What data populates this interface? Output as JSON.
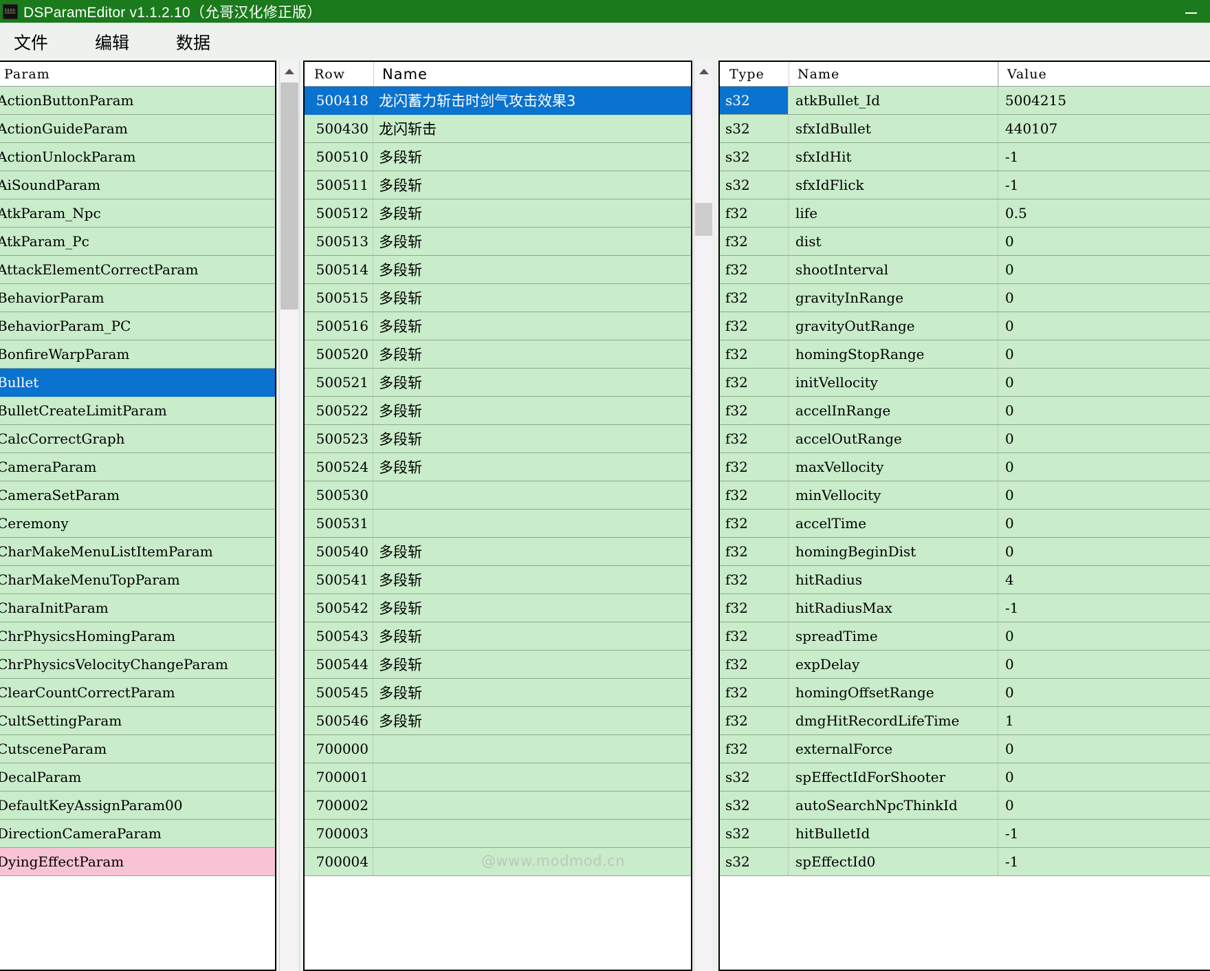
{
  "window": {
    "title": "DSParamEditor v1.1.2.10（允哥汉化修正版）",
    "icon": "app-icon",
    "minimize_label": "—"
  },
  "menubar": {
    "items": [
      {
        "label": "文件"
      },
      {
        "label": "编辑"
      },
      {
        "label": "数据"
      }
    ]
  },
  "param_panel": {
    "header": "Param",
    "selected": "Bullet",
    "items": [
      {
        "label": "ActionButtonParam",
        "state": "normal"
      },
      {
        "label": "ActionGuideParam",
        "state": "normal"
      },
      {
        "label": "ActionUnlockParam",
        "state": "normal"
      },
      {
        "label": "AiSoundParam",
        "state": "normal"
      },
      {
        "label": "AtkParam_Npc",
        "state": "normal"
      },
      {
        "label": "AtkParam_Pc",
        "state": "normal"
      },
      {
        "label": "AttackElementCorrectParam",
        "state": "normal"
      },
      {
        "label": "BehaviorParam",
        "state": "normal"
      },
      {
        "label": "BehaviorParam_PC",
        "state": "normal"
      },
      {
        "label": "BonfireWarpParam",
        "state": "normal"
      },
      {
        "label": "Bullet",
        "state": "selected"
      },
      {
        "label": "BulletCreateLimitParam",
        "state": "normal"
      },
      {
        "label": "CalcCorrectGraph",
        "state": "normal"
      },
      {
        "label": "CameraParam",
        "state": "normal"
      },
      {
        "label": "CameraSetParam",
        "state": "normal"
      },
      {
        "label": "Ceremony",
        "state": "normal"
      },
      {
        "label": "CharMakeMenuListItemParam",
        "state": "normal"
      },
      {
        "label": "CharMakeMenuTopParam",
        "state": "normal"
      },
      {
        "label": "CharaInitParam",
        "state": "normal"
      },
      {
        "label": "ChrPhysicsHomingParam",
        "state": "normal"
      },
      {
        "label": "ChrPhysicsVelocityChangeParam",
        "state": "normal"
      },
      {
        "label": "ClearCountCorrectParam",
        "state": "normal"
      },
      {
        "label": "CultSettingParam",
        "state": "normal"
      },
      {
        "label": "CutsceneParam",
        "state": "normal"
      },
      {
        "label": "DecalParam",
        "state": "normal"
      },
      {
        "label": "DefaultKeyAssignParam00",
        "state": "normal"
      },
      {
        "label": "DirectionCameraParam",
        "state": "normal"
      },
      {
        "label": "DyingEffectParam",
        "state": "pink"
      }
    ]
  },
  "rows_panel": {
    "headers": {
      "row": "Row",
      "name": "Name"
    },
    "rows": [
      {
        "row": "500418",
        "name": "龙闪蓄力斩击时剑气攻击效果3",
        "state": "selected"
      },
      {
        "row": "500430",
        "name": "龙闪斩击",
        "state": "normal"
      },
      {
        "row": "500510",
        "name": "多段斩",
        "state": "normal"
      },
      {
        "row": "500511",
        "name": "多段斩",
        "state": "normal"
      },
      {
        "row": "500512",
        "name": "多段斩",
        "state": "normal"
      },
      {
        "row": "500513",
        "name": "多段斩",
        "state": "normal"
      },
      {
        "row": "500514",
        "name": "多段斩",
        "state": "normal"
      },
      {
        "row": "500515",
        "name": "多段斩",
        "state": "normal"
      },
      {
        "row": "500516",
        "name": "多段斩",
        "state": "normal"
      },
      {
        "row": "500520",
        "name": "多段斩",
        "state": "normal"
      },
      {
        "row": "500521",
        "name": "多段斩",
        "state": "normal"
      },
      {
        "row": "500522",
        "name": "多段斩",
        "state": "normal"
      },
      {
        "row": "500523",
        "name": "多段斩",
        "state": "normal"
      },
      {
        "row": "500524",
        "name": "多段斩",
        "state": "normal"
      },
      {
        "row": "500530",
        "name": "",
        "state": "normal"
      },
      {
        "row": "500531",
        "name": "",
        "state": "normal"
      },
      {
        "row": "500540",
        "name": "多段斩",
        "state": "normal"
      },
      {
        "row": "500541",
        "name": "多段斩",
        "state": "normal"
      },
      {
        "row": "500542",
        "name": "多段斩",
        "state": "normal"
      },
      {
        "row": "500543",
        "name": "多段斩",
        "state": "normal"
      },
      {
        "row": "500544",
        "name": "多段斩",
        "state": "normal"
      },
      {
        "row": "500545",
        "name": "多段斩",
        "state": "normal"
      },
      {
        "row": "500546",
        "name": "多段斩",
        "state": "normal"
      },
      {
        "row": "700000",
        "name": "",
        "state": "normal"
      },
      {
        "row": "700001",
        "name": "",
        "state": "normal"
      },
      {
        "row": "700002",
        "name": "",
        "state": "normal"
      },
      {
        "row": "700003",
        "name": "",
        "state": "normal"
      },
      {
        "row": "700004",
        "name": "",
        "state": "normal"
      }
    ]
  },
  "fields_panel": {
    "headers": {
      "type": "Type",
      "name": "Name",
      "value": "Value"
    },
    "fields": [
      {
        "type": "s32",
        "name": "atkBullet_Id",
        "value": "5004215",
        "state": "selected-cell"
      },
      {
        "type": "s32",
        "name": "sfxIdBullet",
        "value": "440107",
        "state": "normal"
      },
      {
        "type": "s32",
        "name": "sfxIdHit",
        "value": "-1",
        "state": "normal"
      },
      {
        "type": "s32",
        "name": "sfxIdFlick",
        "value": "-1",
        "state": "normal"
      },
      {
        "type": "f32",
        "name": "life",
        "value": "0.5",
        "state": "normal"
      },
      {
        "type": "f32",
        "name": "dist",
        "value": "0",
        "state": "normal"
      },
      {
        "type": "f32",
        "name": "shootInterval",
        "value": "0",
        "state": "normal"
      },
      {
        "type": "f32",
        "name": "gravityInRange",
        "value": "0",
        "state": "normal"
      },
      {
        "type": "f32",
        "name": "gravityOutRange",
        "value": "0",
        "state": "normal"
      },
      {
        "type": "f32",
        "name": "homingStopRange",
        "value": "0",
        "state": "normal"
      },
      {
        "type": "f32",
        "name": "initVellocity",
        "value": "0",
        "state": "normal"
      },
      {
        "type": "f32",
        "name": "accelInRange",
        "value": "0",
        "state": "normal"
      },
      {
        "type": "f32",
        "name": "accelOutRange",
        "value": "0",
        "state": "normal"
      },
      {
        "type": "f32",
        "name": "maxVellocity",
        "value": "0",
        "state": "normal"
      },
      {
        "type": "f32",
        "name": "minVellocity",
        "value": "0",
        "state": "normal"
      },
      {
        "type": "f32",
        "name": "accelTime",
        "value": "0",
        "state": "normal"
      },
      {
        "type": "f32",
        "name": "homingBeginDist",
        "value": "0",
        "state": "normal"
      },
      {
        "type": "f32",
        "name": "hitRadius",
        "value": "4",
        "state": "normal"
      },
      {
        "type": "f32",
        "name": "hitRadiusMax",
        "value": "-1",
        "state": "normal"
      },
      {
        "type": "f32",
        "name": "spreadTime",
        "value": "0",
        "state": "normal"
      },
      {
        "type": "f32",
        "name": "expDelay",
        "value": "0",
        "state": "normal"
      },
      {
        "type": "f32",
        "name": "homingOffsetRange",
        "value": "0",
        "state": "normal"
      },
      {
        "type": "f32",
        "name": "dmgHitRecordLifeTime",
        "value": "1",
        "state": "normal"
      },
      {
        "type": "f32",
        "name": "externalForce",
        "value": "0",
        "state": "normal"
      },
      {
        "type": "s32",
        "name": "spEffectIdForShooter",
        "value": "0",
        "state": "normal"
      },
      {
        "type": "s32",
        "name": "autoSearchNpcThinkId",
        "value": "0",
        "state": "normal"
      },
      {
        "type": "s32",
        "name": "hitBulletId",
        "value": "-1",
        "state": "normal"
      },
      {
        "type": "s32",
        "name": "spEffectId0",
        "value": "-1",
        "state": "normal"
      }
    ]
  },
  "watermark": {
    "text": "@www.modmod.cn"
  },
  "colors": {
    "titlebar": "#1a7a1c",
    "row_green": "#c9ecca",
    "row_selected": "#0a72cf",
    "row_pink": "#f9c3d6",
    "app_background": "#eef2ee"
  }
}
